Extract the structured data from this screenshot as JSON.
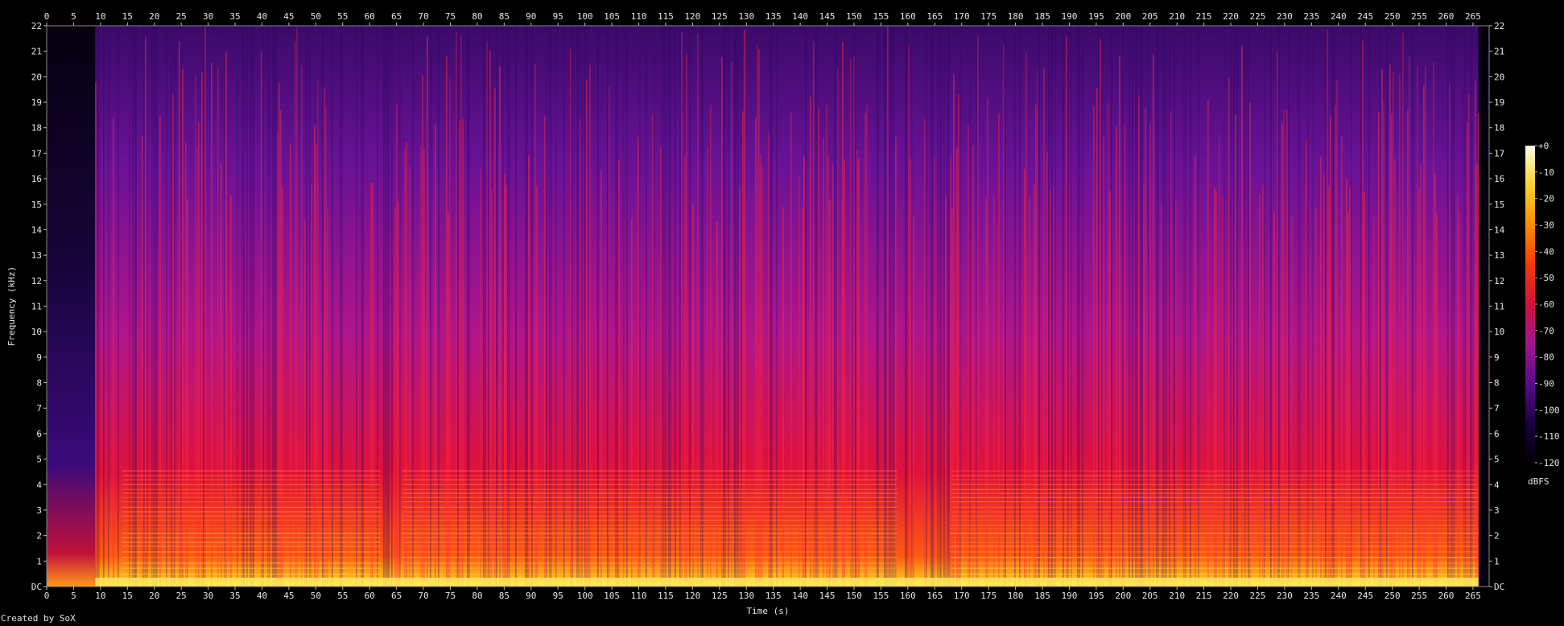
{
  "chart_data": {
    "type": "heatmap",
    "xlabel": "Time (s)",
    "ylabel": "Frequency (kHz)",
    "xlim": [
      0,
      268
    ],
    "ylim": [
      0,
      22
    ],
    "x_ticks": [
      0,
      5,
      10,
      15,
      20,
      25,
      30,
      35,
      40,
      45,
      50,
      55,
      60,
      65,
      70,
      75,
      80,
      85,
      90,
      95,
      100,
      105,
      110,
      115,
      120,
      125,
      130,
      135,
      140,
      145,
      150,
      155,
      160,
      165,
      170,
      175,
      180,
      185,
      190,
      195,
      200,
      205,
      210,
      215,
      220,
      225,
      230,
      235,
      240,
      245,
      250,
      255,
      260,
      265
    ],
    "y_ticks": [
      "DC",
      "1",
      "2",
      "3",
      "4",
      "5",
      "6",
      "7",
      "8",
      "9",
      "10",
      "11",
      "12",
      "13",
      "14",
      "15",
      "16",
      "17",
      "18",
      "19",
      "20",
      "21",
      "22"
    ],
    "colorbar": {
      "label": "dBFS",
      "ticks": [
        "+0",
        "-10",
        "-20",
        "-30",
        "-40",
        "-50",
        "-60",
        "-70",
        "-80",
        "-90",
        "-100",
        "-110",
        "-120"
      ],
      "range": [
        -120,
        0
      ]
    },
    "colormap_stops": [
      "#000000",
      "#1a0046",
      "#5a0a8c",
      "#a0158f",
      "#d2103c",
      "#f53a0a",
      "#ff8c00",
      "#ffd22e",
      "#fffbe6"
    ],
    "quiet_intro_end_s": 9,
    "music_end_s": 266,
    "loud_regions_s": [
      [
        14,
        62
      ],
      [
        66,
        158
      ],
      [
        168,
        266
      ]
    ]
  },
  "credit": "Created by SoX"
}
